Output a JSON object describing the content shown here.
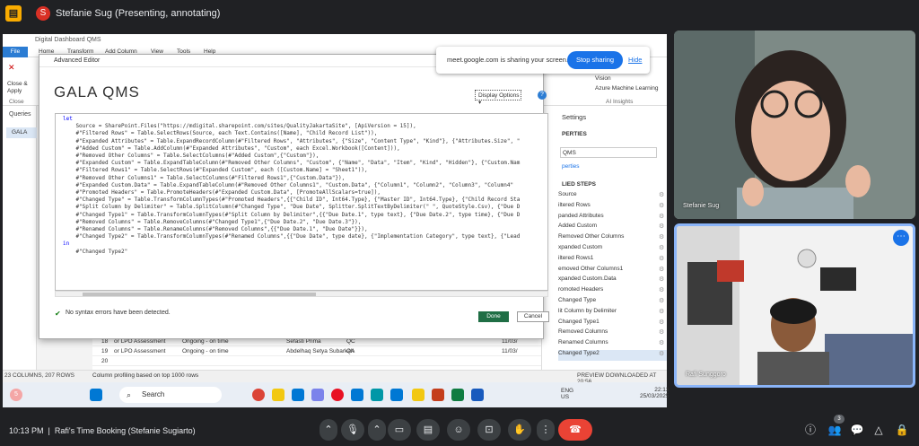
{
  "meet": {
    "presenter_initial": "S",
    "presenter_status": "Stefanie Sug (Presenting, annotating)",
    "time": "10:13 PM",
    "meeting_title": "Rafi's Time Booking (Stefanie Sugiarto)",
    "people_count": "3",
    "share_notice": "meet.google.com is sharing your screen.",
    "stop_sharing": "Stop sharing",
    "hide": "Hide",
    "participants": [
      {
        "name": "Stefanie Sug"
      },
      {
        "name": "Rafi Sunggoro"
      }
    ],
    "accent": "#1a73e8",
    "end_call_color": "#ea4335"
  },
  "pbi": {
    "window_title": "Digital Dashboard QMS",
    "tabs": [
      "File",
      "Home",
      "Transform",
      "Add Column",
      "View",
      "Tools",
      "Help"
    ],
    "ribbon_left": [
      "Close &",
      "Apply",
      "Close"
    ],
    "ribbon_right": [
      "Vision",
      "Azure Machine Learning",
      "AI Insights"
    ],
    "queries_label": "Queries",
    "query_item": "GALA",
    "settings_title": "Settings",
    "properties_label": "PERTIES",
    "name_value": "QMS",
    "all_properties": "perties",
    "applied_steps_label": "LIED STEPS",
    "applied_steps": [
      "Source",
      "iltered Rows",
      "panded Attributes",
      "Added Custom",
      "Removed Other Columns",
      "xpanded Custom",
      "iltered Rows1",
      "emoved Other Columns1",
      "xpanded Custom.Data",
      "romoted Headers",
      "Changed Type",
      "lit Column by Delimiter",
      "Changed Type1",
      "Removed Columns",
      "Renamed Columns",
      "Changed Type2"
    ],
    "rows": [
      {
        "num": "18",
        "col1": "or LPO Assessment",
        "col2": "Ongoing - on time",
        "col3": "Sefasti Prima",
        "col4": "QC",
        "col5": "11/03/"
      },
      {
        "num": "19",
        "col1": "or LPO Assessment",
        "col2": "Ongoing - on time",
        "col3": "Abdelhaq Setya Subarkah",
        "col4": "QA",
        "col5": "11/03/"
      },
      {
        "num": "20",
        "col1": "",
        "col2": "",
        "col3": "",
        "col4": "",
        "col5": ""
      }
    ],
    "status_left": "23 COLUMNS, 207 ROWS",
    "status_left2": "Column profiling based on top 1000 rows",
    "status_right": "PREVIEW DOWNLOADED AT 20:56"
  },
  "editor": {
    "title": "Advanced Editor",
    "heading": "GALA QMS",
    "display_options": "Display Options",
    "code_lines": [
      "let",
      "    Source = SharePoint.Files(\"https://mdigital.sharepoint.com/sites/QualityJakartaSite\", [ApiVersion = 15]),",
      "    #\"Filtered Rows\" = Table.SelectRows(Source, each Text.Contains([Name], \"Child Record List\")),",
      "    #\"Expanded Attributes\" = Table.ExpandRecordColumn(#\"Filtered Rows\", \"Attributes\", {\"Size\", \"Content Type\", \"Kind\"}, {\"Attributes.Size\", \"",
      "    #\"Added Custom\" = Table.AddColumn(#\"Expanded Attributes\", \"Custom\", each Excel.Workbook([Content])),",
      "    #\"Removed Other Columns\" = Table.SelectColumns(#\"Added Custom\",{\"Custom\"}),",
      "    #\"Expanded Custom\" = Table.ExpandTableColumn(#\"Removed Other Columns\", \"Custom\", {\"Name\", \"Data\", \"Item\", \"Kind\", \"Hidden\"}, {\"Custom.Nam",
      "    #\"Filtered Rows1\" = Table.SelectRows(#\"Expanded Custom\", each ([Custom.Name] = \"Sheet1\")),",
      "    #\"Removed Other Columns1\" = Table.SelectColumns(#\"Filtered Rows1\",{\"Custom.Data\"}),",
      "    #\"Expanded Custom.Data\" = Table.ExpandTableColumn(#\"Removed Other Columns1\", \"Custom.Data\", {\"Column1\", \"Column2\", \"Column3\", \"Column4\"",
      "    #\"Promoted Headers\" = Table.PromoteHeaders(#\"Expanded Custom.Data\", [PromoteAllScalars=true]),",
      "    #\"Changed Type\" = Table.TransformColumnTypes(#\"Promoted Headers\",{{\"Child ID\", Int64.Type}, {\"Master ID\", Int64.Type}, {\"Child Record Sta",
      "    #\"Split Column by Delimiter\" = Table.SplitColumn(#\"Changed Type\", \"Due Date\", Splitter.SplitTextByDelimiter(\" \", QuoteStyle.Csv), {\"Due D",
      "    #\"Changed Type1\" = Table.TransformColumnTypes(#\"Split Column by Delimiter\",{{\"Due Date.1\", type text}, {\"Due Date.2\", type time}, {\"Due D",
      "    #\"Removed Columns\" = Table.RemoveColumns(#\"Changed Type1\",{\"Due Date.2\", \"Due Date.3\"}),",
      "    #\"Renamed Columns\" = Table.RenameColumns(#\"Removed Columns\",{{\"Due Date.1\", \"Due Date\"}}),",
      "    #\"Changed Type2\" = Table.TransformColumnTypes(#\"Renamed Columns\",{{\"Due Date\", type date}, {\"Implementation Category\", type text}, {\"Lead",
      "in",
      "    #\"Changed Type2\""
    ],
    "syntax_status": "No syntax errors have been detected.",
    "done": "Done",
    "cancel": "Cancel"
  },
  "taskbar": {
    "search_placeholder": "Search",
    "lang1": "ENG",
    "lang2": "US",
    "clock_time": "22:13",
    "clock_date": "25/03/2025",
    "notification_count": "5"
  }
}
